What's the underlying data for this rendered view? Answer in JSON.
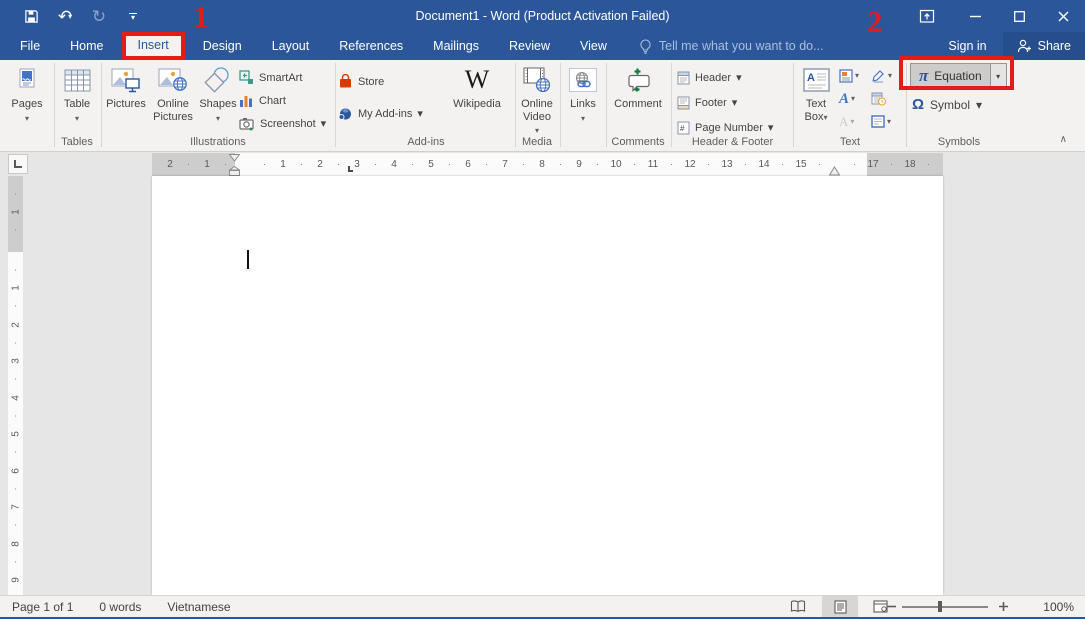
{
  "titlebar": {
    "title": "Document1 - Word (Product Activation Failed)",
    "signin": "Sign in",
    "share": "Share"
  },
  "tabs": {
    "file": "File",
    "home": "Home",
    "insert": "Insert",
    "design": "Design",
    "layout": "Layout",
    "references": "References",
    "mailings": "Mailings",
    "review": "Review",
    "view": "View",
    "tellme": "Tell me what you want to do..."
  },
  "annotations": {
    "step1": "1",
    "step2": "2",
    "color": "#e21b1b"
  },
  "ribbon": {
    "pages": {
      "button": "Pages"
    },
    "tables": {
      "table": "Table",
      "group": "Tables"
    },
    "illustrations": {
      "pictures": "Pictures",
      "online_pictures": "Online Pictures",
      "shapes": "Shapes",
      "smartart": "SmartArt",
      "chart": "Chart",
      "screenshot": "Screenshot",
      "group": "Illustrations"
    },
    "addins": {
      "store": "Store",
      "my_addins": "My Add-ins",
      "wikipedia": "Wikipedia",
      "wiki_glyph": "W",
      "group": "Add-ins"
    },
    "media": {
      "online_video": "Online Video",
      "group": "Media"
    },
    "links": {
      "links": "Links"
    },
    "comments": {
      "comment": "Comment",
      "group": "Comments"
    },
    "header_footer": {
      "header": "Header",
      "footer": "Footer",
      "page_number": "Page Number",
      "group": "Header & Footer"
    },
    "text": {
      "text_box_1": "Text",
      "text_box_2": "Box",
      "group": "Text"
    },
    "symbols": {
      "equation": "Equation",
      "pi": "π",
      "symbol": "Symbol",
      "omega": "Ω",
      "group": "Symbols"
    }
  },
  "ruler": {
    "h_margin_left": [
      "2",
      "1"
    ],
    "h_main": [
      "1",
      "2",
      "3",
      "4",
      "5",
      "6",
      "7",
      "8",
      "9",
      "10",
      "11",
      "12",
      "13",
      "14",
      "15"
    ],
    "h_margin_right": [
      "17",
      "18"
    ],
    "v_margin_top": [
      "1"
    ],
    "v_main": [
      "1",
      "2",
      "3",
      "4",
      "5",
      "6",
      "7",
      "8",
      "9"
    ]
  },
  "statusbar": {
    "page_count": "Page 1 of 1",
    "word_count": "0 words",
    "language": "Vietnamese",
    "zoom_level": "100%"
  }
}
